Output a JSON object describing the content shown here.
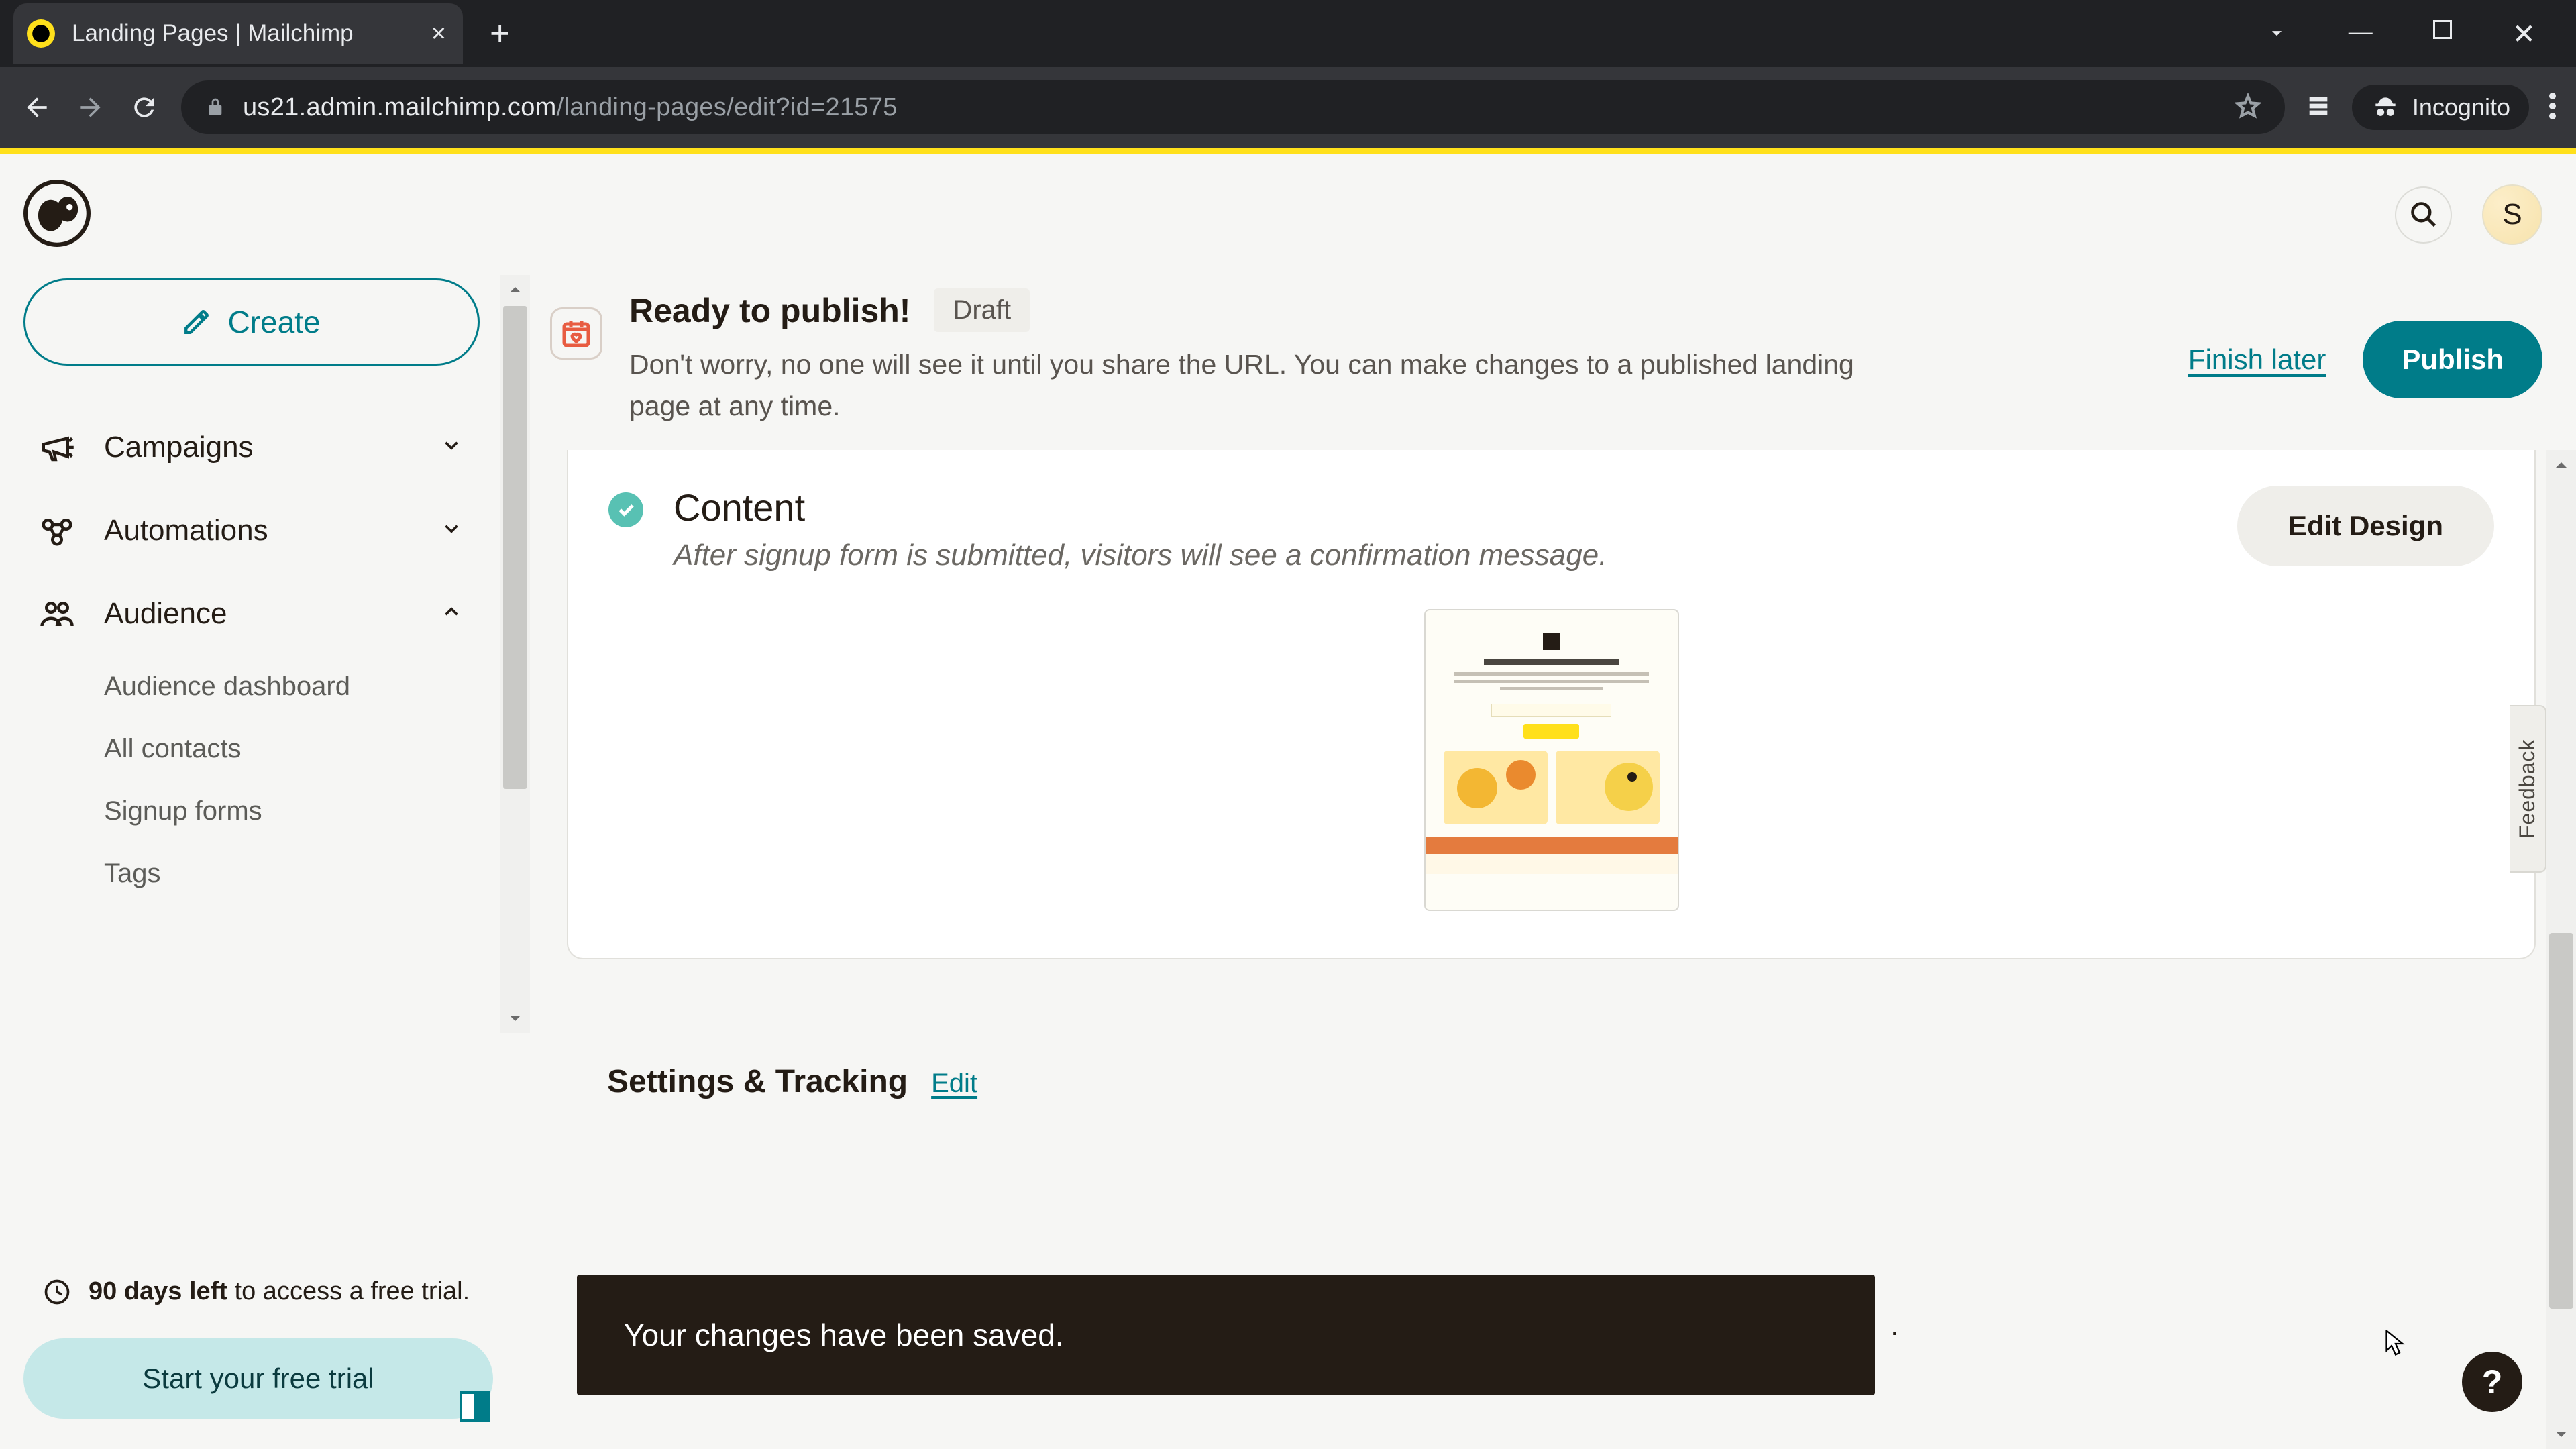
{
  "browser": {
    "tab_title": "Landing Pages | Mailchimp",
    "url_host": "us21.admin.mailchimp.com",
    "url_path": "/landing-pages/edit?id=21575",
    "incognito_label": "Incognito"
  },
  "header": {
    "avatar_initial": "S"
  },
  "sidebar": {
    "create_label": "Create",
    "items": [
      {
        "label": "Campaigns",
        "expanded": false
      },
      {
        "label": "Automations",
        "expanded": false
      },
      {
        "label": "Audience",
        "expanded": true
      }
    ],
    "audience_children": [
      "Audience dashboard",
      "All contacts",
      "Signup forms",
      "Tags"
    ],
    "trial": {
      "bold": "90 days left",
      "rest": " to access a free trial.",
      "cta": "Start your free trial"
    }
  },
  "topbar": {
    "title": "Ready to publish!",
    "status_badge": "Draft",
    "description": "Don't worry, no one will see it until you share the URL. You can make changes to a published landing page at any time.",
    "finish_later": "Finish later",
    "publish": "Publish"
  },
  "sections": {
    "content": {
      "title": "Content",
      "subtitle": "After signup form is submitted, visitors will see a confirmation message.",
      "edit_design": "Edit Design"
    },
    "settings": {
      "title": "Settings & Tracking",
      "edit": "Edit",
      "hidden_trailing": "."
    }
  },
  "toast": {
    "message": "Your changes have been saved."
  },
  "feedback_tab": "Feedback",
  "help_fab": "?"
}
